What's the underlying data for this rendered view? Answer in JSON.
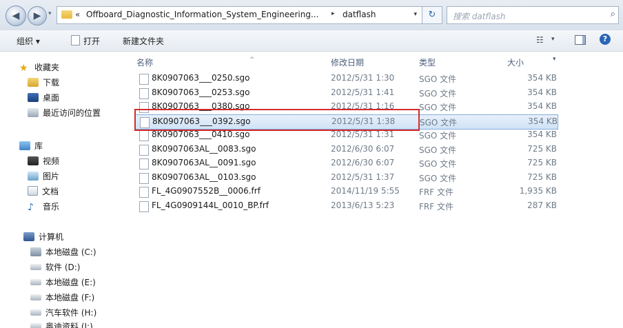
{
  "address_bar": {
    "recent_glyph": "▾",
    "path_chevron": "«",
    "path_segment_1": "Offboard_Diagnostic_Information_System_Engineering...",
    "path_separator": "▸",
    "path_segment_2": "datflash",
    "dropdown_glyph": "▾",
    "refresh_glyph": "↻",
    "search_placeholder": "搜索 datflash",
    "search_glyph": "⌕"
  },
  "toolbar": {
    "organize_label": "组织 ▾",
    "open_label": "打开",
    "new_folder_label": "新建文件夹",
    "view_glyph": "☷",
    "view_drop_glyph": "▾",
    "help_glyph": "?"
  },
  "nav": {
    "favorites_header": "收藏夹",
    "favorites": [
      "下载",
      "桌面",
      "最近访问的位置"
    ],
    "libraries_header": "库",
    "libraries": [
      "视频",
      "图片",
      "文档",
      "音乐"
    ],
    "computer_header": "计算机",
    "drives": [
      "本地磁盘 (C:)",
      "软件 (D:)",
      "本地磁盘 (E:)",
      "本地磁盘 (F:)",
      "汽车软件 (H:)",
      "奥迪资料 (I:)"
    ],
    "star_glyph": "★",
    "music_glyph": "♪"
  },
  "columns": {
    "name": "名称",
    "modified": "修改日期",
    "type": "类型",
    "size": "大小",
    "sort_glyph": "^",
    "size_drop_glyph": "▾"
  },
  "files": [
    {
      "name": "8K0907063___0250.sgo",
      "modified": "2012/5/31 1:30",
      "type": "SGO 文件",
      "size": "354 KB"
    },
    {
      "name": "8K0907063___0253.sgo",
      "modified": "2012/5/31 1:41",
      "type": "SGO 文件",
      "size": "354 KB"
    },
    {
      "name": "8K0907063___0380.sgo",
      "modified": "2012/5/31 1:16",
      "type": "SGO 文件",
      "size": "354 KB"
    },
    {
      "name": "8K0907063___0392.sgo",
      "modified": "2012/5/31 1:38",
      "type": "SGO 文件",
      "size": "354 KB"
    },
    {
      "name": "8K0907063___0410.sgo",
      "modified": "2012/5/31 1:31",
      "type": "SGO 文件",
      "size": "354 KB"
    },
    {
      "name": "8K0907063AL__0083.sgo",
      "modified": "2012/6/30 6:07",
      "type": "SGO 文件",
      "size": "725 KB"
    },
    {
      "name": "8K0907063AL__0091.sgo",
      "modified": "2012/6/30 6:07",
      "type": "SGO 文件",
      "size": "725 KB"
    },
    {
      "name": "8K0907063AL__0103.sgo",
      "modified": "2012/5/31 1:37",
      "type": "SGO 文件",
      "size": "725 KB"
    },
    {
      "name": "FL_4G0907552B__0006.frf",
      "modified": "2014/11/19 5:55",
      "type": "FRF 文件",
      "size": "1,935 KB"
    },
    {
      "name": "FL_4G0909144L_0010_BP.frf",
      "modified": "2013/6/13 5:23",
      "type": "FRF 文件",
      "size": "287 KB"
    }
  ],
  "selected_file_index": 3,
  "colors": {
    "highlight_border": "#d42a2a",
    "selection_fill": "#cfe2f6"
  }
}
